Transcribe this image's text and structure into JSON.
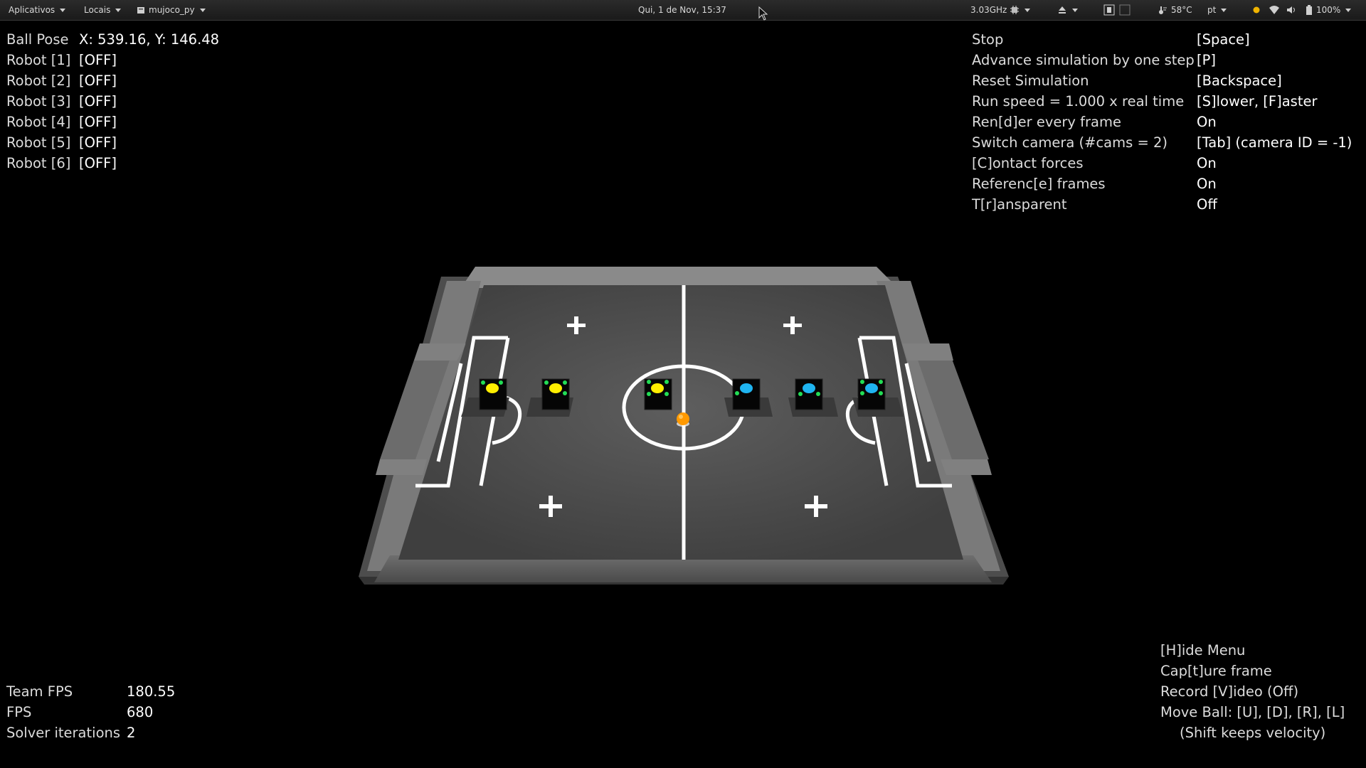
{
  "topbar": {
    "apps_label": "Aplicativos",
    "places_label": "Locais",
    "window_label": "mujoco_py",
    "clock": "Qui,  1 de Nov, 15:37",
    "cpu_freq": "3.03GHz",
    "temperature": "58°C",
    "keyboard_layout": "pt",
    "battery": "100%"
  },
  "overlay_top_left": [
    {
      "label": "Ball Pose",
      "value": "X: 539.16, Y: 146.48"
    },
    {
      "label": "Robot [1]",
      "value": "[OFF]"
    },
    {
      "label": "Robot [2]",
      "value": "[OFF]"
    },
    {
      "label": "Robot [3]",
      "value": "[OFF]"
    },
    {
      "label": "Robot [4]",
      "value": "[OFF]"
    },
    {
      "label": "Robot [5]",
      "value": "[OFF]"
    },
    {
      "label": "Robot [6]",
      "value": "[OFF]"
    }
  ],
  "overlay_top_right": [
    {
      "label": "Stop",
      "value": "[Space]"
    },
    {
      "label": "Advance simulation by one step",
      "value": "[P]"
    },
    {
      "label": "Reset Simulation",
      "value": "[Backspace]"
    },
    {
      "label": "Run speed = 1.000 x real time",
      "value": "[S]lower, [F]aster"
    },
    {
      "label": "Ren[d]er every frame",
      "value": "On"
    },
    {
      "label": "Switch camera (#cams = 2)",
      "value": "[Tab] (camera ID = -1)"
    },
    {
      "label": "[C]ontact forces",
      "value": "On"
    },
    {
      "label": "Referenc[e] frames",
      "value": "On"
    },
    {
      "label": "T[r]ansparent",
      "value": "Off"
    }
  ],
  "overlay_bottom_left": [
    {
      "label": "Team FPS",
      "value": "180.55"
    },
    {
      "label": "FPS",
      "value": "680"
    },
    {
      "label": "Solver iterations",
      "value": "2"
    }
  ],
  "overlay_bottom_right": [
    "[H]ide Menu",
    "Cap[t]ure frame",
    "Record [V]ideo (Off)",
    "Move Ball: [U], [D], [R], [L]",
    "(Shift keeps velocity)"
  ],
  "colors": {
    "team_yellow": "#ffee00",
    "team_blue": "#1fb4f0",
    "marker_green": "#22dd55",
    "ball": "#ff9900",
    "field": "#585858",
    "wall": "#7a7a7a"
  }
}
